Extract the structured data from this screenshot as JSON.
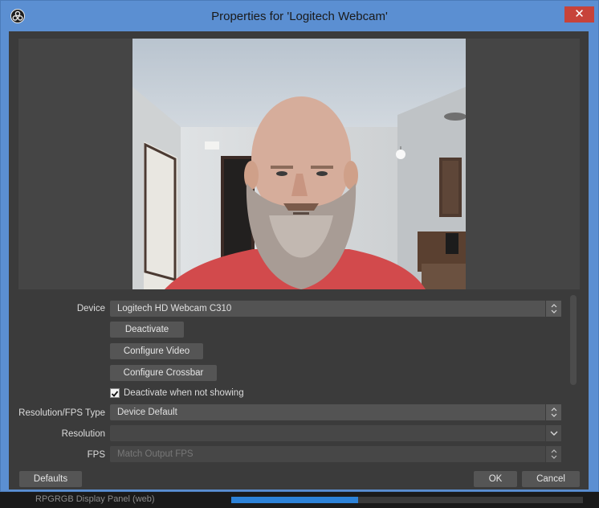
{
  "window": {
    "title": "Properties for 'Logitech Webcam'",
    "close_glyph": "✕"
  },
  "properties": {
    "device_label": "Device",
    "device_value": "Logitech HD Webcam C310",
    "deactivate_button": "Deactivate",
    "configure_video_button": "Configure Video",
    "configure_crossbar_button": "Configure Crossbar",
    "deactivate_when_not_showing_label": "Deactivate when not showing",
    "deactivate_when_not_showing_checked": true,
    "resolution_fps_type_label": "Resolution/FPS Type",
    "resolution_fps_type_value": "Device Default",
    "resolution_label": "Resolution",
    "resolution_value": "",
    "fps_label": "FPS",
    "fps_value": "Match Output FPS"
  },
  "footer": {
    "defaults_button": "Defaults",
    "ok_button": "OK",
    "cancel_button": "Cancel"
  },
  "background": {
    "taskbar_text": "RPGRGB Display Panel (web)"
  },
  "colors": {
    "title_bar": "#5b8fd2",
    "close_button": "#c7433a",
    "dialog_bg": "#3b3b3b"
  }
}
